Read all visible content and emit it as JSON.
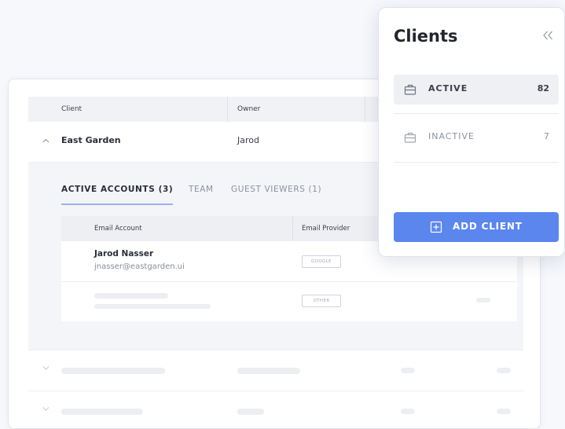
{
  "main": {
    "table_headers": {
      "client": "Client",
      "owner": "Owner"
    },
    "rows": [
      {
        "client": "East Garden",
        "owner": "Jarod"
      }
    ],
    "tabs": [
      {
        "label": "ACTIVE ACCOUNTS (3)",
        "active": true
      },
      {
        "label": "TEAM",
        "active": false
      },
      {
        "label": "GUEST VIEWERS (1)",
        "active": false
      }
    ],
    "email_table": {
      "headers": {
        "email_account": "Email Account",
        "email_provider": "Email Provider"
      },
      "rows": [
        {
          "name": "Jarod Nasser",
          "email": "jnasser@eastgarden.ui",
          "provider": "GOOGLE"
        },
        {
          "provider": "OTHER"
        }
      ]
    }
  },
  "side_panel": {
    "title": "Clients",
    "collapse_icon": "double-chevron-left-icon",
    "items": [
      {
        "label": "ACTIVE",
        "count": "82",
        "icon": "briefcase-icon",
        "active": true
      },
      {
        "label": "INACTIVE",
        "count": "7",
        "icon": "briefcase-icon",
        "active": false
      }
    ],
    "add_button": {
      "label": "ADD CLIENT",
      "icon": "plus-square-icon"
    }
  },
  "colors": {
    "accent": "#5b86ee",
    "tab_underline": "#9bb0ee",
    "background": "#f6f8fc"
  }
}
